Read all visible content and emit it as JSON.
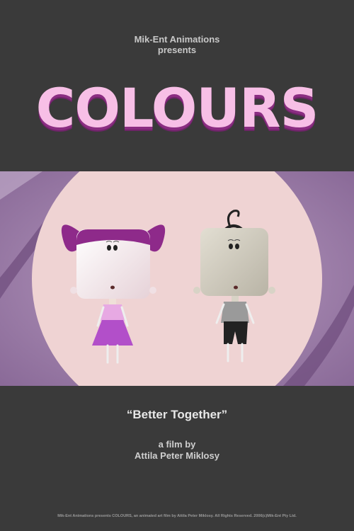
{
  "presenter": {
    "line1": "Mik-Ent Animations",
    "line2": "presents"
  },
  "title": "COLOURS",
  "tagline": "“Better Together”",
  "credit": {
    "line1": "a film by",
    "line2": "Attila Peter Miklosy"
  },
  "footer": "Mik-Ent Animations presents COLOURS, an animated art film by Attila Peter Miklosy. All Rights Reserved. 2006(c)Mik-Ent Pty Ltd.",
  "colors": {
    "background": "#3a3a3a",
    "title_fill": "#f7bfe6",
    "title_shadow": "#8b2d82",
    "scene_purple": "#9a7ba6",
    "spotlight": "#efd3d3",
    "girl_hair": "#8e2a8a",
    "girl_skirt": "#b24fc9",
    "boy_head": "#d4cfc2"
  }
}
